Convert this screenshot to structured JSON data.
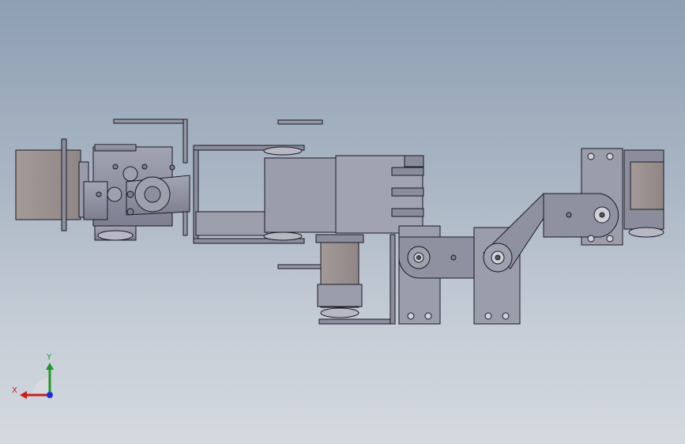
{
  "view": {
    "background_top": "#8e9fb2",
    "background_bottom": "#d4d9df"
  },
  "triad": {
    "x_label": "X",
    "y_label": "Y",
    "x_color": "#c81e1e",
    "y_color": "#1f9a2a",
    "z_color": "#1f2fd6"
  },
  "model": {
    "part_fill": "#8a8c9c",
    "part_fill_light": "#a6a7b5",
    "motor_fill": "#9a9190",
    "edge_color": "#1a1a22"
  }
}
